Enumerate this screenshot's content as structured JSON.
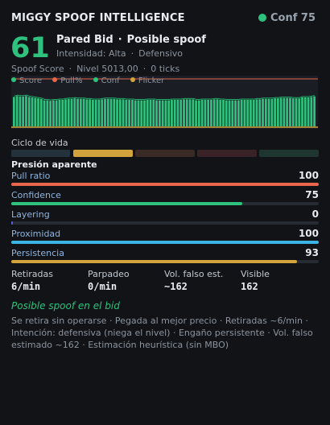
{
  "header": {
    "title": "MIGGY SPOOF INTELLIGENCE",
    "conf_label": "Conf 75",
    "status_color": "#2ec27e"
  },
  "summary": {
    "score": "61",
    "side": "Pared Bid",
    "verdict": "Posible spoof",
    "separator": "·",
    "intensity": "Intensidad: Alta",
    "mode": "Defensivo",
    "score_label": "Spoof Score",
    "level": "Nivel 5013,00",
    "ticks": "0 ticks"
  },
  "legend": [
    {
      "label": "Score",
      "color": "#2ec27e"
    },
    {
      "label": "Pull%",
      "color": "#e8664a"
    },
    {
      "label": "Conf",
      "color": "#2ec27e"
    },
    {
      "label": "Flicker",
      "color": "#d4a43c"
    }
  ],
  "chart_data": {
    "type": "area",
    "series": [
      {
        "name": "Score",
        "color": "#2ec27e",
        "values": [
          62,
          64,
          63,
          63,
          64,
          62,
          61,
          60,
          59,
          58,
          55,
          55,
          54,
          55,
          55,
          56,
          56,
          57,
          58,
          58,
          59,
          58,
          58,
          58,
          57,
          57,
          56,
          56,
          56,
          57,
          58,
          58,
          58,
          58,
          57,
          57,
          57,
          56,
          56,
          56,
          55,
          55,
          55,
          55,
          56,
          56,
          56,
          55,
          55,
          55,
          55,
          55,
          56,
          56,
          56,
          56,
          57,
          57,
          57,
          57,
          55,
          55,
          56,
          56,
          56,
          56,
          57,
          57,
          56,
          56,
          55,
          55,
          55,
          55,
          55,
          56,
          56,
          56,
          56,
          56,
          57,
          57,
          58,
          58,
          58,
          58,
          59,
          59,
          60,
          60,
          60,
          60,
          59,
          59,
          59,
          61,
          61,
          61,
          62,
          63
        ]
      },
      {
        "name": "Pull%",
        "color": "#e8664a",
        "values": [
          100
        ]
      },
      {
        "name": "Flicker",
        "color": "#d4a43c",
        "values": [
          0
        ]
      }
    ],
    "ylim": [
      0,
      100
    ]
  },
  "lifecycle": {
    "label": "Ciclo de vida",
    "stages": [
      {
        "color": "#23323d"
      },
      {
        "color": "#d4a43c"
      },
      {
        "color": "#3a2a24"
      },
      {
        "color": "#3a2326"
      },
      {
        "color": "#1f3630"
      }
    ]
  },
  "pressure": {
    "title": "Presión aparente",
    "metrics": [
      {
        "label": "Pull ratio",
        "value": "100",
        "level": 100,
        "color": "#e8664a"
      },
      {
        "label": "Confidence",
        "value": "75",
        "level": 75,
        "color": "#2ec27e"
      },
      {
        "label": "Layering",
        "value": "0",
        "level": 0,
        "color": "#5b5fe8"
      },
      {
        "label": "Proximidad",
        "value": "100",
        "level": 100,
        "color": "#3db4e6"
      },
      {
        "label": "Persistencia",
        "value": "93",
        "level": 93,
        "color": "#d4a43c"
      }
    ]
  },
  "stats": [
    {
      "label": "Retiradas",
      "value": "6/min"
    },
    {
      "label": "Parpadeo",
      "value": "0/min"
    },
    {
      "label": "Vol. falso est.",
      "value": "~162"
    },
    {
      "label": "Visible",
      "value": "162"
    }
  ],
  "assessment": {
    "title": "Posible spoof en el bid",
    "details": "Se retira sin operarse  ·  Pegada al mejor precio  ·  Retiradas ~6/min  ·  Intención: defensiva (niega el nivel)  ·  Engaño persistente  ·  Vol. falso estimado ~162  ·  Estimación heurística (sin MBO)"
  }
}
